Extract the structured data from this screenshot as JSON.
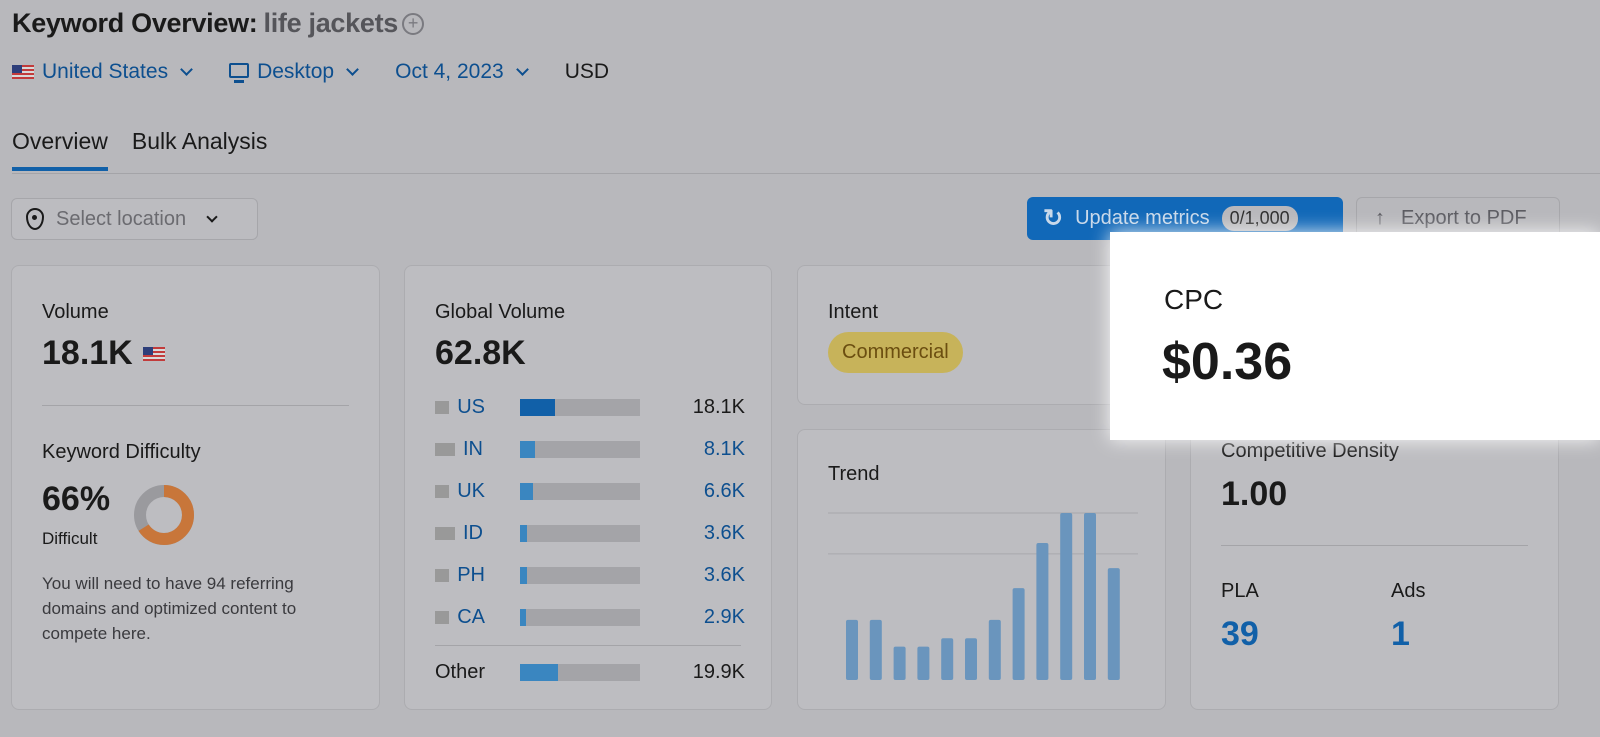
{
  "header": {
    "title": "Keyword Overview:",
    "keyword": "life jackets",
    "add_icon": "plus-circle-icon"
  },
  "filters": {
    "country": "United States",
    "device": "Desktop",
    "date": "Oct 4, 2023",
    "currency": "USD"
  },
  "tabs": [
    {
      "label": "Overview",
      "active": true
    },
    {
      "label": "Bulk Analysis",
      "active": false
    }
  ],
  "location": {
    "placeholder": "Select location"
  },
  "toolbar": {
    "update_label": "Update metrics",
    "update_count": "0/1,000",
    "export_label": "Export to PDF"
  },
  "volume": {
    "label": "Volume",
    "value": "18.1K"
  },
  "kd": {
    "label": "Keyword Difficulty",
    "value": "66%",
    "percent": 66,
    "level": "Difficult",
    "description": "You will need to have 94 referring domains and optimized content to compete here.",
    "colors": {
      "fill": "#c8763a",
      "rest": "#9a9a9e"
    }
  },
  "global": {
    "label": "Global Volume",
    "value": "62.8K",
    "total": 62.8,
    "countries": [
      {
        "code": "US",
        "value": "18.1K",
        "num": 18.1
      },
      {
        "code": "IN",
        "value": "8.1K",
        "num": 8.1
      },
      {
        "code": "UK",
        "value": "6.6K",
        "num": 6.6
      },
      {
        "code": "ID",
        "value": "3.6K",
        "num": 3.6
      },
      {
        "code": "PH",
        "value": "3.6K",
        "num": 3.6
      },
      {
        "code": "CA",
        "value": "2.9K",
        "num": 2.9
      }
    ],
    "other": {
      "label": "Other",
      "value": "19.9K",
      "num": 19.9
    }
  },
  "intent": {
    "label": "Intent",
    "value": "Commercial"
  },
  "trend": {
    "label": "Trend"
  },
  "chart_data": {
    "type": "bar",
    "title": "Trend",
    "values_relative": [
      0.36,
      0.36,
      0.2,
      0.2,
      0.25,
      0.25,
      0.36,
      0.55,
      0.82,
      1,
      1,
      0.67
    ],
    "grid": true,
    "color": "#6a95bd"
  },
  "cpc": {
    "label": "CPC",
    "value": "$0.36"
  },
  "cd": {
    "label": "Competitive Density",
    "value": "1.00",
    "pla_label": "PLA",
    "pla": "39",
    "ads_label": "Ads",
    "ads": "1"
  }
}
